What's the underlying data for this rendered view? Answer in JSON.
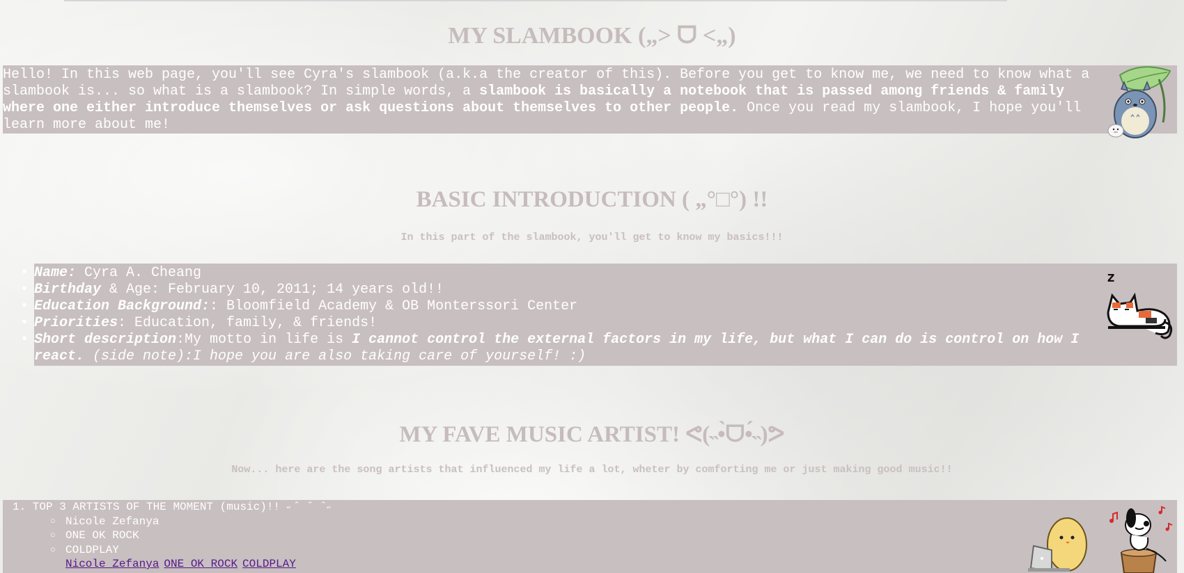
{
  "header": {
    "title": "MY SLAMBOOK („> ᗜ <„)"
  },
  "intro": {
    "part1": "Hello! In this web page, you'll see Cyra's slambook (a.k.a the creator of this). Before you get to know me, we need to know what a slambook is... so what is a slambook? In simple words, a ",
    "bold": "slambook is basically a notebook that is passed among friends & family where one either introduce themselves or ask questions about themselves to other people.",
    "part2": " Once you read my slambook, I hope you'll learn more about me!"
  },
  "basics": {
    "title": "BASIC INTRODUCTION ( „°□°) !!",
    "subtitle": "In this part of the slambook, you'll get to know my basics!!!",
    "items": [
      {
        "label": "Name:",
        "value": " Cyra A. Cheang"
      },
      {
        "label": "Birthday",
        "value": " & Age: February 10, 2011; 14 years old!!"
      },
      {
        "label": "Education Background:",
        "value": ": Bloomfield Academy & OB Monterssori Center"
      },
      {
        "label": "Priorities",
        "value": ": Education, family, & friends!"
      }
    ],
    "short": {
      "label": "Short description",
      "text": ":My motto in life is ",
      "motto": "I cannot control the external factors in my life, but what I can do is control on how I react.",
      "note": " (side note):I hope you are also taking care of yourself! :)"
    }
  },
  "music": {
    "title": "MY FAVE MUSIC ARTIST! ᕙ(˵•̀ᗜ•́˵)ᕗ",
    "subtitle": "Now... here are the song artists that influenced my life a lot, wheter by comforting me or just making good music!!",
    "list_heading": "1. TOP 3 ARTISTS OF THE MOMENT (music)!! ˶ˆ ˘ ˆ˶",
    "artists": [
      "Nicole Zefanya",
      "ONE OK ROCK",
      "COLDPLAY"
    ],
    "links": [
      "Nicole Zefanya",
      "ONE OK ROCK",
      "COLDPLAY"
    ]
  },
  "stickers": {
    "totoro": "totoro-leaf-sticker",
    "cat": "sleeping-cat-sticker",
    "chick": "chick-laptop-sticker",
    "snoopy": "snoopy-music-sticker",
    "cat_sleep_letter": "z"
  }
}
